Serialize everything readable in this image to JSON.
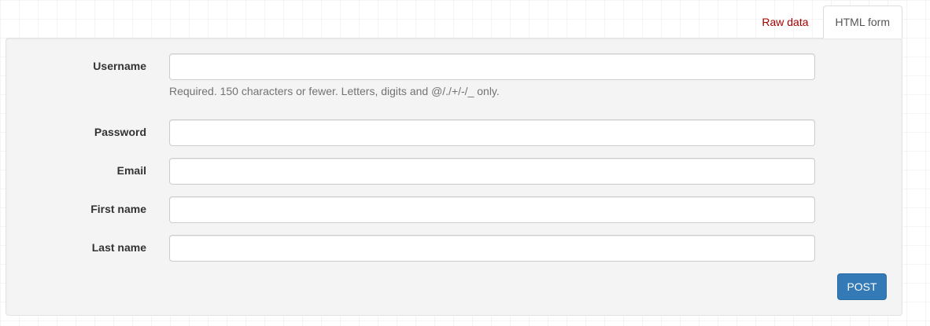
{
  "tabs": {
    "raw_label": "Raw data",
    "html_label": "HTML form"
  },
  "form": {
    "username": {
      "label": "Username",
      "value": "",
      "help": "Required. 150 characters or fewer. Letters, digits and @/./+/-/_ only."
    },
    "password": {
      "label": "Password",
      "value": ""
    },
    "email": {
      "label": "Email",
      "value": ""
    },
    "first_name": {
      "label": "First name",
      "value": ""
    },
    "last_name": {
      "label": "Last name",
      "value": ""
    },
    "submit_label": "POST"
  },
  "colors": {
    "accent": "#337ab7",
    "raw_tab": "#a30000",
    "panel": "#f4f4f4"
  }
}
